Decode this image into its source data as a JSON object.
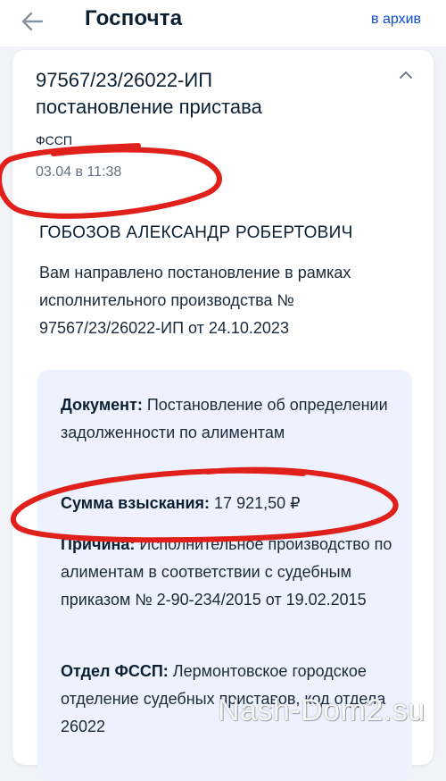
{
  "header": {
    "title": "Госпочта",
    "archive_label": "в архив"
  },
  "message": {
    "number": "97567/23/26022-ИП",
    "subject": "постановление пристава",
    "sender": "ФССП",
    "datetime": "03.04 в 11:38",
    "recipient": "ГОБОЗОВ АЛЕКСАНДР РОБЕРТОВИЧ",
    "intro": "Вам направлено постановление в рамках исполнительного производства № 97567/23/26022-ИП от 24.10.2023"
  },
  "details": {
    "document_label": "Документ:",
    "document_value": "Постановление об определении задолженности по алиментам",
    "amount_label": "Сумма взыскания:",
    "amount_value": "17 921,50 ₽",
    "reason_label": "Причина:",
    "reason_value": "Исполнительное производство по алиментам в соответствии с судебным приказом № 2-90-234/2015 от 19.02.2015",
    "department_label": "Отдел ФССП:",
    "department_value": "Лермонтовское городское отделение судебных приставов, код отдела 26022"
  },
  "watermark": "Nash-Dom2.su",
  "colors": {
    "accent": "#0d4cd3",
    "marker": "#e0201b",
    "details_bg": "#edf2fe"
  }
}
